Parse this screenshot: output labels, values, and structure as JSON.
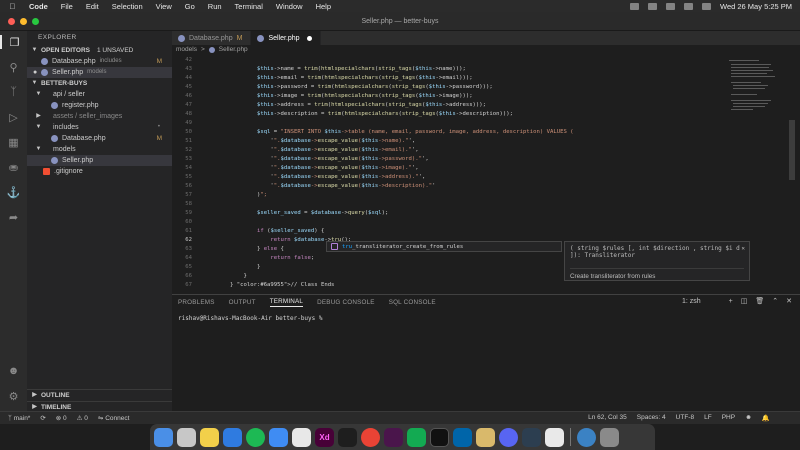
{
  "menubar": {
    "app": "Code",
    "items": [
      "File",
      "Edit",
      "Selection",
      "View",
      "Go",
      "Run",
      "Terminal",
      "Window",
      "Help"
    ],
    "datetime": "Wed 26 May  5:25 PM"
  },
  "window": {
    "title": "Seller.php — better-buys"
  },
  "sidebar": {
    "explorer_label": "EXPLORER",
    "open_editors_label": "OPEN EDITORS",
    "unsaved_badge": "1 UNSAVED",
    "open_editors": [
      {
        "name": "Database.php",
        "hint": "includes",
        "status": "M"
      },
      {
        "name": "Seller.php",
        "hint": "models",
        "status": ""
      }
    ],
    "project_label": "BETTER-BUYS",
    "tree": [
      {
        "name": "api / seller",
        "type": "folder",
        "level": 1
      },
      {
        "name": "register.php",
        "type": "file",
        "level": 2
      },
      {
        "name": "assets / seller_images",
        "type": "folder",
        "level": 1
      },
      {
        "name": "includes",
        "type": "folder",
        "level": 1,
        "status": "•"
      },
      {
        "name": "Database.php",
        "type": "file",
        "level": 2,
        "status": "M"
      },
      {
        "name": "models",
        "type": "folder",
        "level": 1
      },
      {
        "name": "Seller.php",
        "type": "file",
        "level": 2
      },
      {
        "name": ".gitignore",
        "type": "git",
        "level": 1
      }
    ],
    "outline_label": "OUTLINE",
    "timeline_label": "TIMELINE"
  },
  "tabs": [
    {
      "name": "Database.php",
      "status": "M",
      "active": false
    },
    {
      "name": "Seller.php",
      "status": "",
      "active": true
    }
  ],
  "breadcrumbs": [
    "models",
    ">",
    "Seller.php"
  ],
  "code": [
    {
      "n": "42",
      "text": ""
    },
    {
      "n": "43",
      "text": "        $this->name = trim(htmlspecialchars(strip_tags($this->name)));"
    },
    {
      "n": "44",
      "text": "        $this->email = trim(htmlspecialchars(strip_tags($this->email)));"
    },
    {
      "n": "45",
      "text": "        $this->password = trim(htmlspecialchars(strip_tags($this->password)));"
    },
    {
      "n": "46",
      "text": "        $this->image = trim(htmlspecialchars(strip_tags($this->image)));"
    },
    {
      "n": "47",
      "text": "        $this->address = trim(htmlspecialchars(strip_tags($this->address)));"
    },
    {
      "n": "48",
      "text": "        $this->description = trim(htmlspecialchars(strip_tags($this->description)));"
    },
    {
      "n": "49",
      "text": ""
    },
    {
      "n": "50",
      "text": "        $sql = \"INSERT INTO $this->table (name, email, password, image, address, description) VALUES ("
    },
    {
      "n": "51",
      "text": "            '\".$database->escape_value($this->name).\"',"
    },
    {
      "n": "52",
      "text": "            '\".$database->escape_value($this->email).\"',"
    },
    {
      "n": "53",
      "text": "            '\".$database->escape_value($this->password).\"',"
    },
    {
      "n": "54",
      "text": "            '\".$database->escape_value($this->image).\"',"
    },
    {
      "n": "55",
      "text": "            '\".$database->escape_value($this->address).\"',"
    },
    {
      "n": "56",
      "text": "            '\".$database->escape_value($this->description).\"'"
    },
    {
      "n": "57",
      "text": "        )\";"
    },
    {
      "n": "58",
      "text": ""
    },
    {
      "n": "59",
      "text": "        $seller_saved = $database->query($sql);"
    },
    {
      "n": "60",
      "text": ""
    },
    {
      "n": "61",
      "text": "        if ($seller_saved) {"
    },
    {
      "n": "62",
      "text": "            return $database->tru();"
    },
    {
      "n": "63",
      "text": "        } else {"
    },
    {
      "n": "64",
      "text": "            return false;"
    },
    {
      "n": "65",
      "text": "        }"
    },
    {
      "n": "66",
      "text": "    }"
    },
    {
      "n": "67",
      "text": "} // Class Ends"
    }
  ],
  "colors": {
    "variable": "#9cdcfe",
    "function": "#dcdcaa",
    "keyword": "#c586c0",
    "string": "#ce9178",
    "comment": "#6a9955",
    "php_icon": "#8892bf",
    "git_icon": "#f14e32"
  },
  "suggest": {
    "match": "tru",
    "rest": "_transliterator_create_from_rules"
  },
  "signature": {
    "text": "( string $rules [, int $direction , string $i d ]): Transliterator",
    "description": "Create transliterator from rules"
  },
  "panel": {
    "tabs": [
      "PROBLEMS",
      "OUTPUT",
      "TERMINAL",
      "DEBUG CONSOLE",
      "SQL CONSOLE"
    ],
    "active_tab": "TERMINAL",
    "shell": "1: zsh",
    "prompt": "rishav@Rishavs-MacBook-Air better-buys %"
  },
  "statusbar": {
    "branch": "main*",
    "connect": "Connect",
    "position": "Ln 62, Col 35",
    "spaces": "Spaces: 4",
    "encoding": "UTF-8",
    "eol": "LF",
    "language": "PHP"
  },
  "dock": [
    "Finder",
    "Launchpad",
    "Notes",
    "Safari",
    "Spotify",
    "Mail",
    "Photo Booth",
    "Xd",
    "Figma",
    "Chrome",
    "Slack",
    "MongoDB",
    "Terminal",
    "VS Code",
    "Preview",
    "Discord",
    "Activity",
    "Bear",
    "Screenshot",
    "Trash"
  ]
}
